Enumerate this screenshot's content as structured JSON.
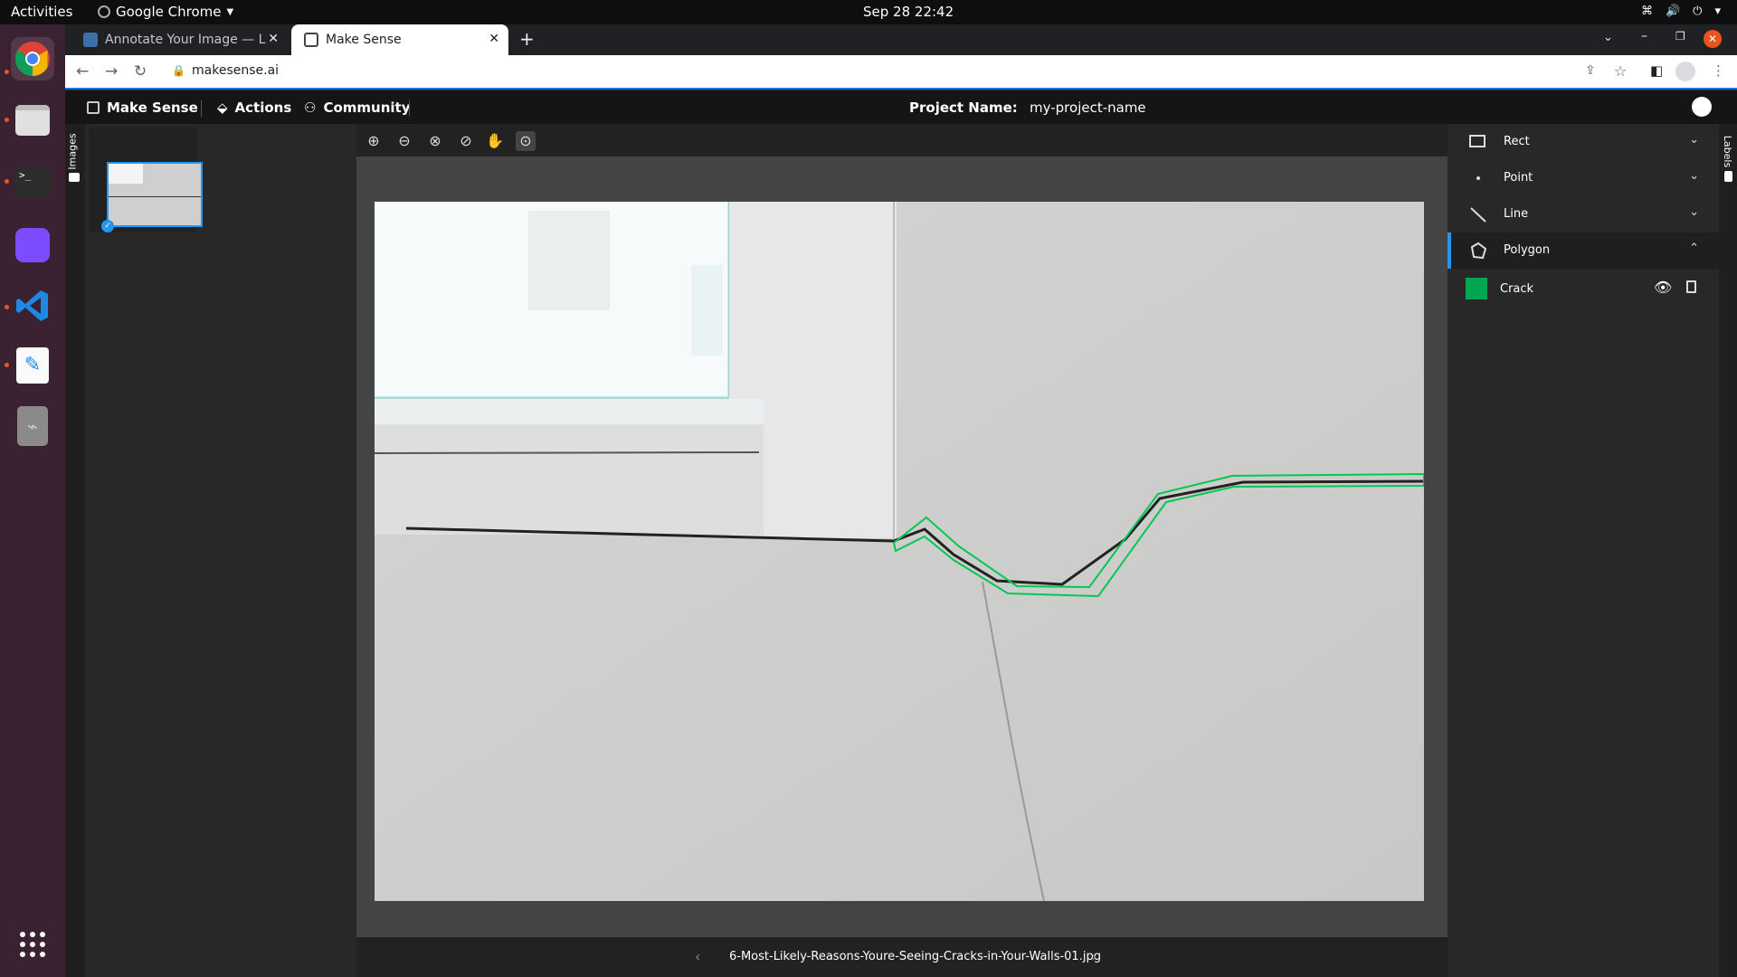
{
  "topbar": {
    "activities": "Activities",
    "app_name": "Google Chrome",
    "clock": "Sep 28  22:42"
  },
  "browser": {
    "tabs": [
      {
        "label": "Annotate Your Image — L",
        "active": false
      },
      {
        "label": "Make Sense",
        "active": true
      }
    ],
    "url": "makesense.ai"
  },
  "app": {
    "brand": "Make Sense",
    "nav": {
      "actions": "Actions",
      "community": "Community"
    },
    "project_label": "Project Name:",
    "project_name": "my-project-name",
    "left_tab": "Images",
    "right_tab": "Labels",
    "label_types": [
      {
        "name": "Rect",
        "expanded": false
      },
      {
        "name": "Point",
        "expanded": false
      },
      {
        "name": "Line",
        "expanded": false
      },
      {
        "name": "Polygon",
        "expanded": true
      }
    ],
    "labels": [
      {
        "name": "Crack",
        "color": "#00a651"
      }
    ],
    "filename": "6-Most-Likely-Reasons-Youre-Seeing-Cracks-in-Your-Walls-01.jpg"
  },
  "colors": {
    "accent": "#2196f3",
    "polygon": "#00c853",
    "label_color": "#00a651"
  }
}
